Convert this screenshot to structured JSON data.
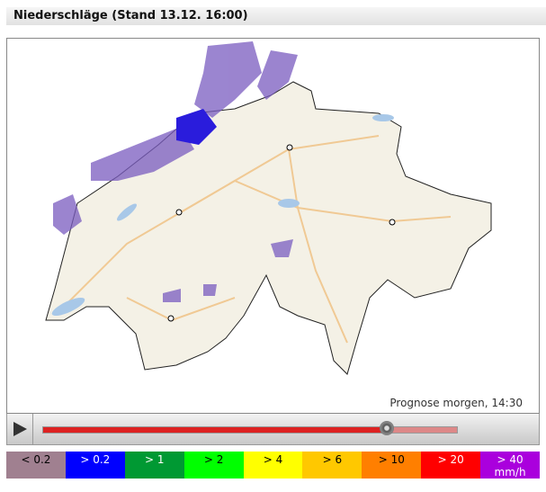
{
  "title": "Niederschläge (Stand 13.12. 16:00)",
  "forecast_label": "Prognose morgen, 14:30",
  "slider": {
    "progress_percent": 83
  },
  "legend": [
    {
      "label": "< 0.2",
      "color": "#a08090",
      "text": "#000"
    },
    {
      "label": "> 0.2",
      "color": "#0000ff",
      "text": "#fff"
    },
    {
      "label": "> 1",
      "color": "#009933",
      "text": "#fff"
    },
    {
      "label": "> 2",
      "color": "#00ff00",
      "text": "#000"
    },
    {
      "label": "> 4",
      "color": "#ffff00",
      "text": "#000"
    },
    {
      "label": "> 6",
      "color": "#ffc800",
      "text": "#000"
    },
    {
      "label": "> 10",
      "color": "#ff7f00",
      "text": "#000"
    },
    {
      "label": "> 20",
      "color": "#ff0000",
      "text": "#fff"
    },
    {
      "label": "> 40",
      "unit": "mm/h",
      "color": "#aa00dd",
      "text": "#fff"
    }
  ]
}
